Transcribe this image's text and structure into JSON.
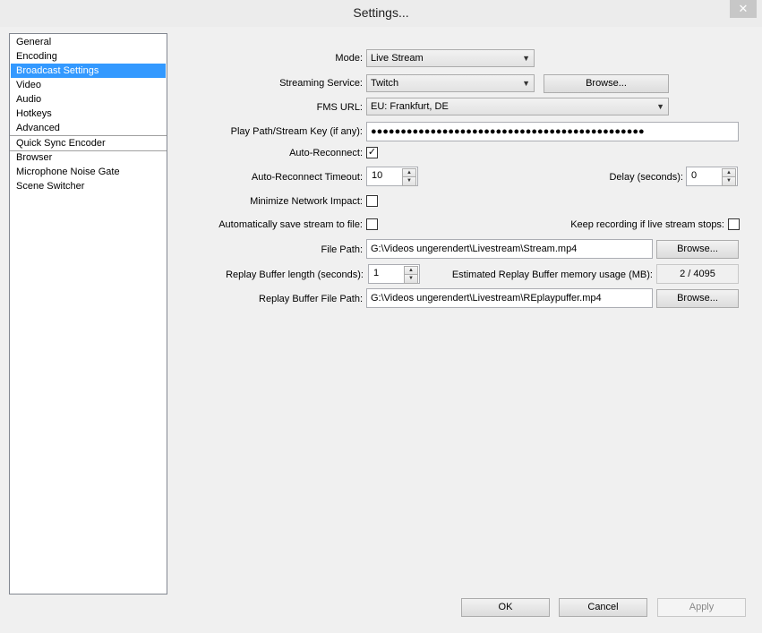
{
  "window": {
    "title": "Settings..."
  },
  "sidebar": {
    "items": [
      {
        "label": "General"
      },
      {
        "label": "Encoding"
      },
      {
        "label": "Broadcast Settings"
      },
      {
        "label": "Video"
      },
      {
        "label": "Audio"
      },
      {
        "label": "Hotkeys"
      },
      {
        "label": "Advanced"
      },
      {
        "label": "Quick Sync Encoder"
      },
      {
        "label": "Browser"
      },
      {
        "label": "Microphone Noise Gate"
      },
      {
        "label": "Scene Switcher"
      }
    ],
    "selected": "Broadcast Settings"
  },
  "form": {
    "mode": {
      "label": "Mode:",
      "value": "Live Stream"
    },
    "streaming_service": {
      "label": "Streaming Service:",
      "value": "Twitch",
      "browse": "Browse..."
    },
    "fms_url": {
      "label": "FMS URL:",
      "value": "EU: Frankfurt, DE"
    },
    "stream_key": {
      "label": "Play Path/Stream Key (if any):",
      "value": "●●●●●●●●●●●●●●●●●●●●●●●●●●●●●●●●●●●●●●●●●●●●●●"
    },
    "auto_reconnect": {
      "label": "Auto-Reconnect:",
      "checked": true
    },
    "auto_reconnect_timeout": {
      "label": "Auto-Reconnect Timeout:",
      "value": "10"
    },
    "delay": {
      "label": "Delay (seconds):",
      "value": "0"
    },
    "minimize_network": {
      "label": "Minimize Network Impact:",
      "checked": false
    },
    "auto_save": {
      "label": "Automatically save stream to file:",
      "checked": false
    },
    "keep_recording": {
      "label": "Keep recording if live stream stops:",
      "checked": false
    },
    "file_path": {
      "label": "File Path:",
      "value": "G:\\Videos ungerendert\\Livestream\\Stream.mp4",
      "browse": "Browse..."
    },
    "replay_buffer_length": {
      "label": "Replay Buffer length (seconds):",
      "value": "1"
    },
    "replay_memory": {
      "label": "Estimated Replay Buffer memory usage (MB):",
      "value": "2 / 4095"
    },
    "replay_file_path": {
      "label": "Replay Buffer File Path:",
      "value": "G:\\Videos ungerendert\\Livestream\\REplaypuffer.mp4",
      "browse": "Browse..."
    }
  },
  "buttons": {
    "ok": "OK",
    "cancel": "Cancel",
    "apply": "Apply"
  },
  "icons": {
    "close": "close-icon",
    "dropdown": "chevron-down-icon",
    "spin_up": "arrow-up-icon",
    "spin_down": "arrow-down-icon",
    "check": "checkmark-icon"
  },
  "colors": {
    "selection": "#3399ff",
    "background": "#f0f0f0"
  }
}
